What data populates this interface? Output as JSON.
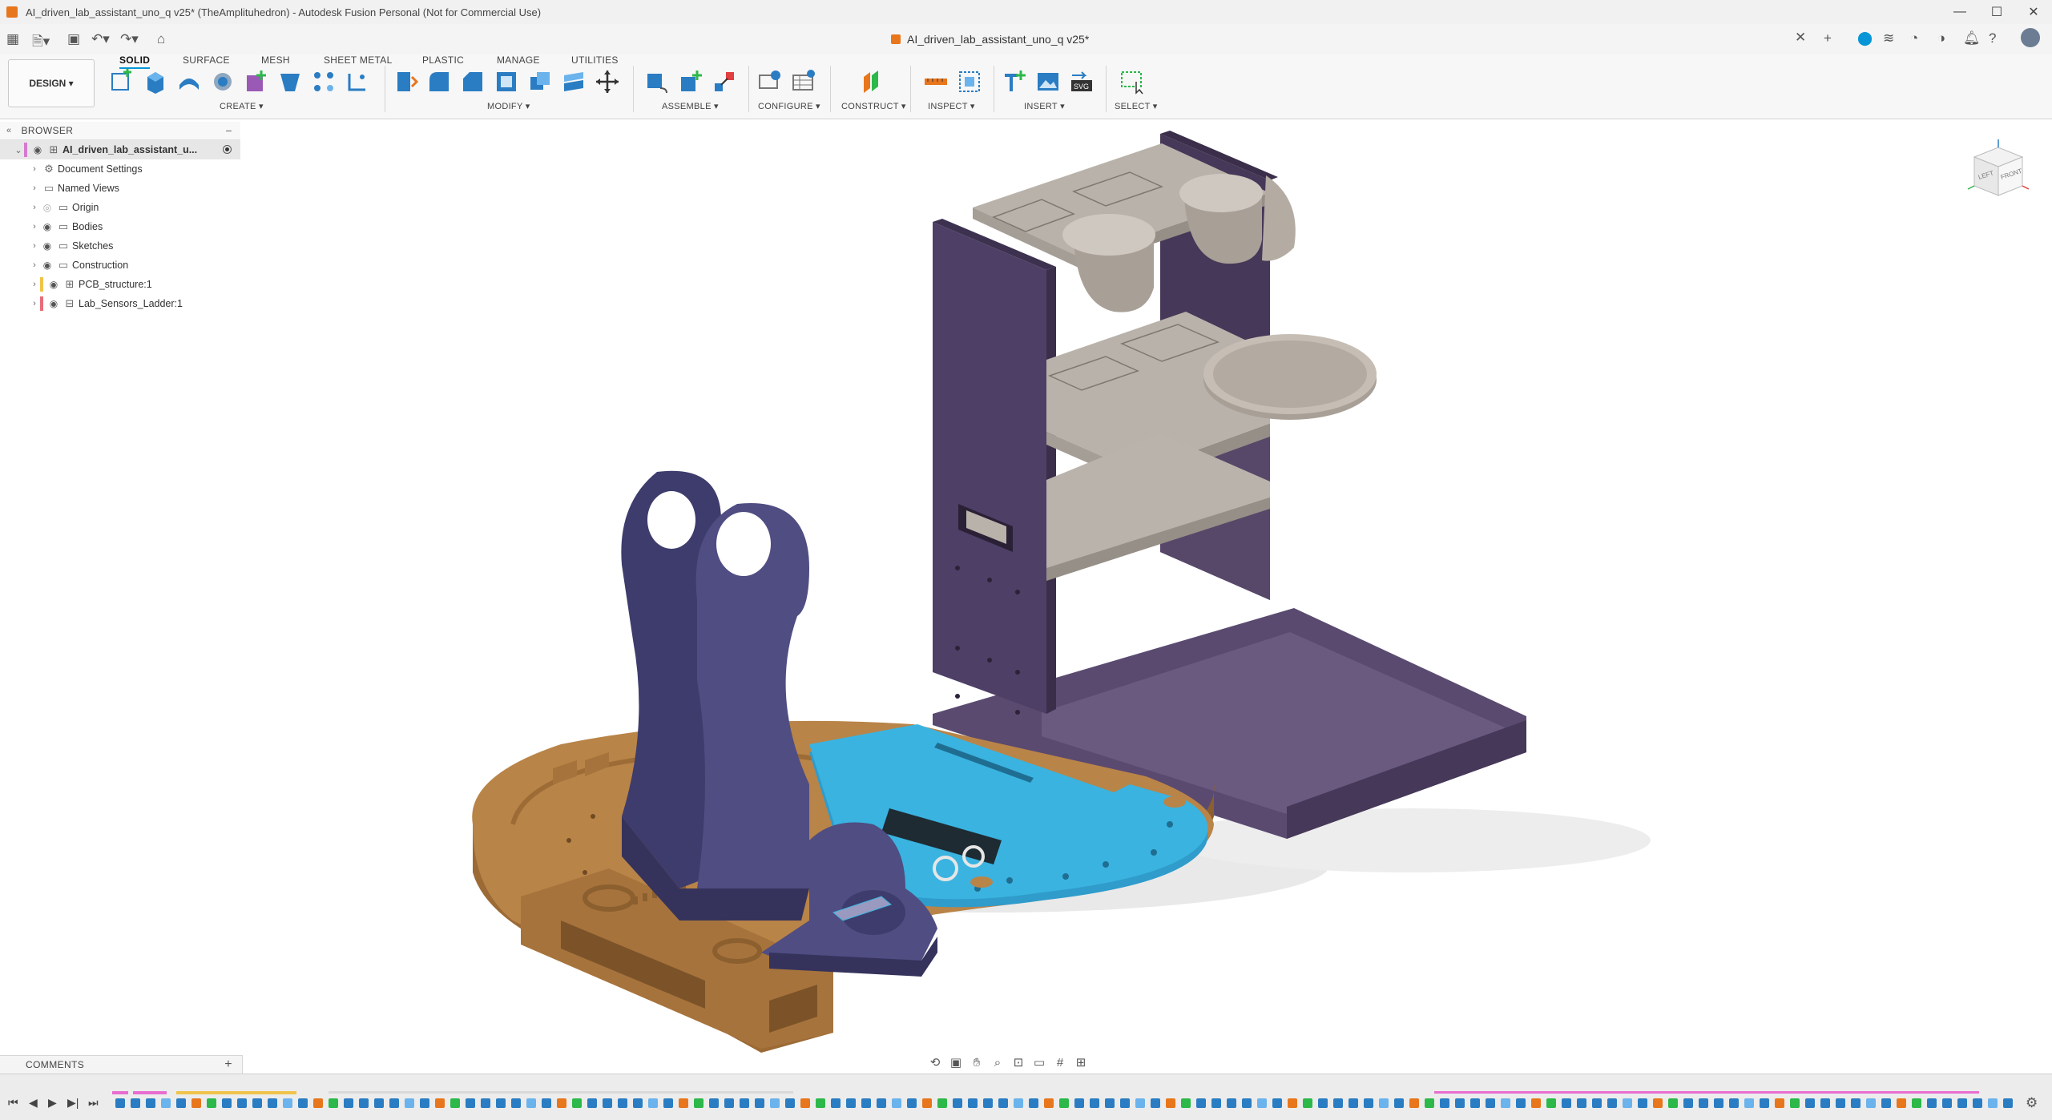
{
  "window": {
    "title": "AI_driven_lab_assistant_uno_q v25* (TheAmplituhedron) - Autodesk Fusion Personal (Not for Commercial Use)",
    "minimize": "—",
    "maximize": "☐",
    "close": "✕"
  },
  "quick_access": {
    "doc_tab_title": "AI_driven_lab_assistant_uno_q v25*",
    "close_tab": "✕",
    "new_tab": "+"
  },
  "ribbon": {
    "workspace": "DESIGN ▾",
    "tabs": [
      "SOLID",
      "SURFACE",
      "MESH",
      "SHEET METAL",
      "PLASTIC",
      "MANAGE",
      "UTILITIES"
    ],
    "groups": [
      "CREATE ▾",
      "MODIFY ▾",
      "ASSEMBLE ▾",
      "CONFIGURE ▾",
      "CONSTRUCT ▾",
      "INSPECT ▾",
      "INSERT ▾",
      "SELECT ▾"
    ]
  },
  "browser": {
    "header": "BROWSER",
    "root": "AI_driven_lab_assistant_u...",
    "items": [
      {
        "label": "Document Settings",
        "icon": "gear-icon"
      },
      {
        "label": "Named Views",
        "icon": "folder-icon"
      },
      {
        "label": "Origin",
        "icon": "folder-icon"
      },
      {
        "label": "Bodies",
        "icon": "folder-icon"
      },
      {
        "label": "Sketches",
        "icon": "folder-icon"
      },
      {
        "label": "Construction",
        "icon": "folder-icon"
      },
      {
        "label": "PCB_structure:1",
        "icon": "component-icon"
      },
      {
        "label": "Lab_Sensors_Ladder:1",
        "icon": "component-icon"
      }
    ]
  },
  "viewcube": {
    "left": "LEFT",
    "front": "FRONT"
  },
  "comments": {
    "label": "COMMENTS",
    "add": "+"
  },
  "colors": {
    "accent": "#0696d7",
    "base_wood": "#b98448",
    "pcb_blue": "#3ab3e0",
    "frame_purple": "#4e3f66",
    "shelf_grey": "#b9b2aa",
    "stand_indigo": "#4f4d82"
  }
}
